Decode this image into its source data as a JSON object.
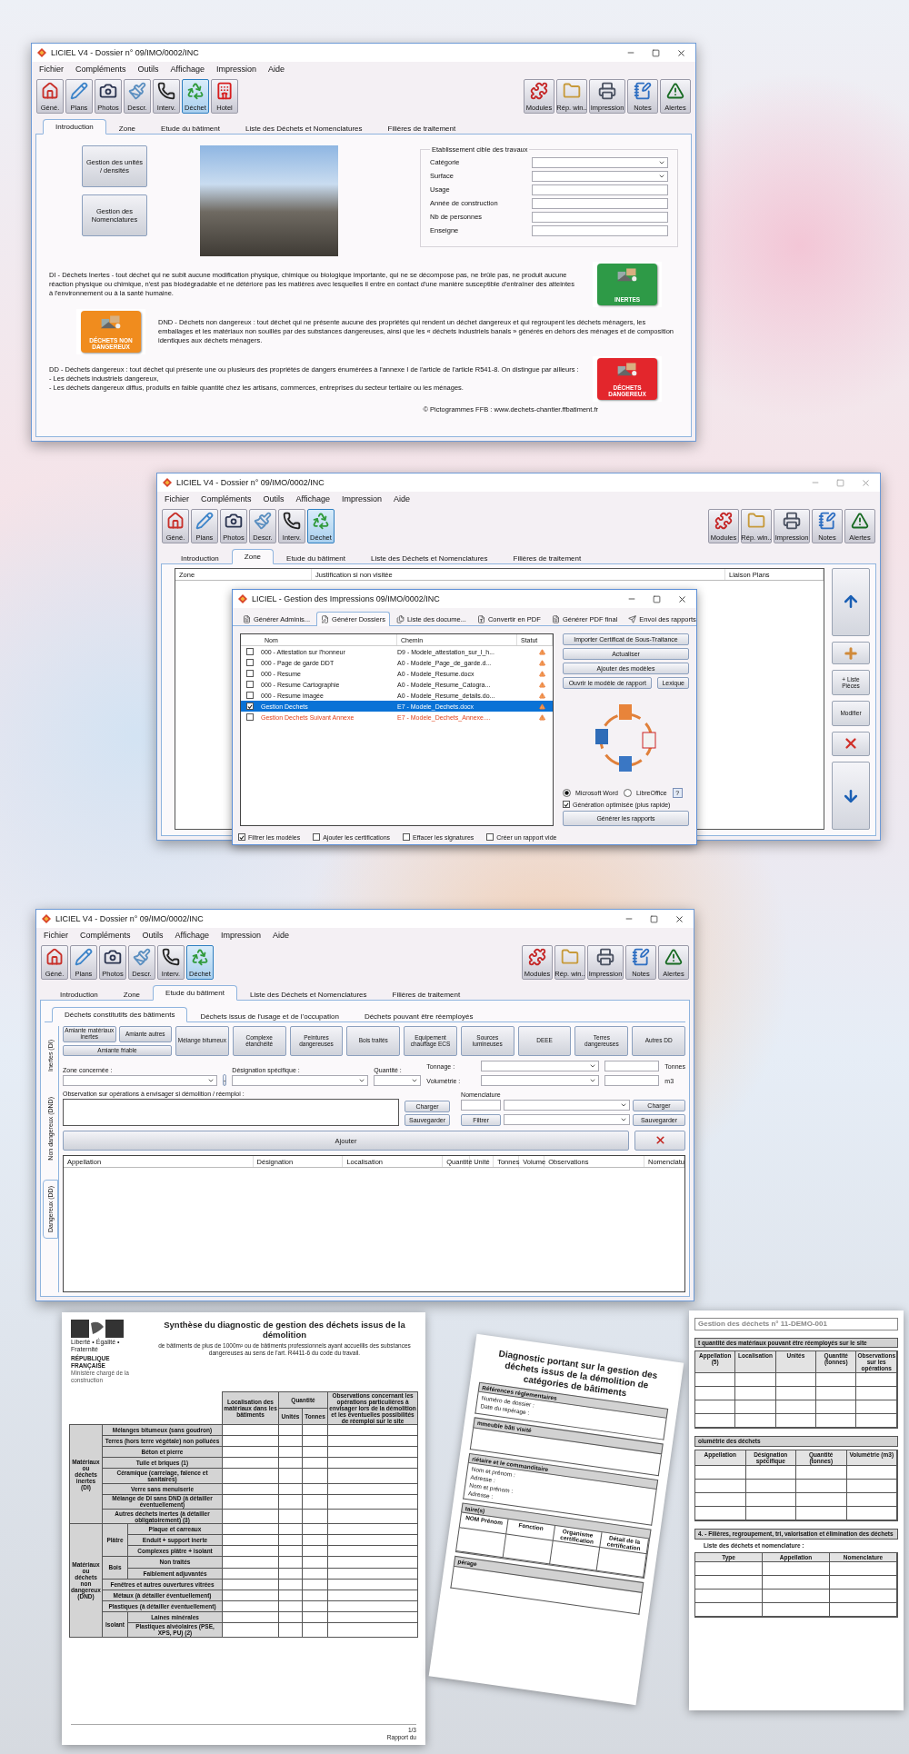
{
  "windows": [
    {
      "kind": "introduction",
      "title": "LICIEL V4 - Dossier n° 09/IMO/0002/INC",
      "menu": [
        "Fichier",
        "Compléments",
        "Outils",
        "Affichage",
        "Impression",
        "Aide"
      ],
      "tools": [
        {
          "label": "Géné.",
          "selected": false
        },
        {
          "label": "Plans",
          "selected": false
        },
        {
          "label": "Photos",
          "selected": false
        },
        {
          "label": "Descr.",
          "selected": false
        },
        {
          "label": "Interv.",
          "selected": false
        },
        {
          "label": "Déchet",
          "selected": true
        },
        {
          "label": "Hotel",
          "selected": false
        }
      ],
      "right_tools": [
        "Modules",
        "Rép. win..",
        "Impression",
        "Notes",
        "Alertes"
      ],
      "tabs": [
        {
          "label": "Introduction",
          "selected": true
        },
        {
          "label": "Zone",
          "selected": false
        },
        {
          "label": "Etude du bâtiment",
          "selected": false
        },
        {
          "label": "Liste des Déchets et Nomenclatures",
          "selected": false
        },
        {
          "label": "Filières de traitement",
          "selected": false
        }
      ],
      "intro": {
        "buttons": [
          "Gestion des unités / densités",
          "Gestion des Nomenclatures"
        ],
        "form_title": "Etablissement cible des travaux",
        "fields": [
          {
            "label": "Catégorie",
            "kind": "select"
          },
          {
            "label": "Surface",
            "kind": "select"
          },
          {
            "label": "Usage",
            "kind": "text"
          },
          {
            "label": "Année de construction",
            "kind": "text"
          },
          {
            "label": "Nb de personnes",
            "kind": "text"
          },
          {
            "label": "Enseigne",
            "kind": "text"
          }
        ],
        "paragraphs": [
          {
            "text": "DI - Déchets Inertes - tout déchet qui ne subit aucune modification physique, chimique ou biologique importante, qui ne se décompose pas, ne brûle pas, ne produit aucune réaction physique ou chimique, n'est pas biodégradable et ne détériore pas les matières avec lesquelles il entre en contact d'une manière susceptible d'entraîner des atteintes à l'environnement ou à la santé humaine.",
            "badge": {
              "label": "INERTES",
              "color": "#2e9a47"
            }
          },
          {
            "text": "DND - Déchets non dangereux : tout déchet qui ne présente aucune des propriétés qui rendent un déchet dangereux et qui regroupent les déchets ménagers, les emballages et les matériaux non souillés par des substances dangereuses, ainsi que les « déchets industriels banals » générés en dehors des ménages et de composition identiques aux déchets ménagers.",
            "badge": {
              "label": "DÉCHETS NON DANGEREUX",
              "color": "#f08c1e"
            }
          },
          {
            "text": "DD - Déchets dangereux : tout déchet qui présente une ou plusieurs des propriétés de dangers énumérées à l'annexe I de l'article de l'article R541-8. On distingue par ailleurs :",
            "bullets": [
              "- Les déchets industriels dangereux,",
              "- Les déchets dangereux diffus, produits en faible quantité chez les artisans, commerces, entreprises du secteur tertiaire ou les ménages."
            ],
            "badge": {
              "label": "DÉCHETS DANGEREUX",
              "color": "#e3262c"
            }
          }
        ],
        "credit": "© Pictogrammes FFB :  www.dechets-chantier.ffbatiment.fr"
      }
    },
    {
      "kind": "zones",
      "title": "LICIEL V4 - Dossier n° 09/IMO/0002/INC",
      "menu": [
        "Fichier",
        "Compléments",
        "Outils",
        "Affichage",
        "Impression",
        "Aide"
      ],
      "tools": [
        {
          "label": "Géné.",
          "selected": false
        },
        {
          "label": "Plans",
          "selected": false
        },
        {
          "label": "Photos",
          "selected": false
        },
        {
          "label": "Descr.",
          "selected": false
        },
        {
          "label": "Interv.",
          "selected": false
        },
        {
          "label": "Déchet",
          "selected": true
        }
      ],
      "right_tools": [
        "Modules",
        "Rép. win..",
        "Impression",
        "Notes",
        "Alertes"
      ],
      "tabs": [
        {
          "label": "Introduction",
          "selected": false
        },
        {
          "label": "Zone",
          "selected": true
        },
        {
          "label": "Etude du bâtiment",
          "selected": false
        },
        {
          "label": "Liste des Déchets et Nomenclatures",
          "selected": false
        },
        {
          "label": "Filières de traitement",
          "selected": false
        }
      ],
      "zones": {
        "columns": [
          "Zone",
          "Justification si non visitée",
          "Liaison Plans"
        ],
        "side_buttons": [
          {
            "kind": "up"
          },
          {
            "kind": "add"
          },
          {
            "kind": "text",
            "label": "+ Liste Pièces"
          },
          {
            "kind": "text",
            "label": "Modifier"
          },
          {
            "kind": "delete"
          },
          {
            "kind": "down"
          }
        ],
        "dialog": {
          "title": "LICIEL - Gestion des Impressions  09/IMO/0002/INC",
          "tabs": [
            {
              "label": "Générer Adminis...",
              "selected": false
            },
            {
              "label": "Générer Dossiers",
              "selected": true
            },
            {
              "label": "Liste des docume...",
              "selected": false
            },
            {
              "label": "Convertir en PDF",
              "selected": false
            },
            {
              "label": "Générer PDF final",
              "selected": false
            },
            {
              "label": "Envoi des rapports",
              "selected": false
            }
          ],
          "columns": [
            "Nom",
            "Chemin",
            "Statut"
          ],
          "rows": [
            {
              "name": "000 - Attestation sur l'honneur",
              "path": "D9 - Modele_attestation_sur_l_h...",
              "checked": false,
              "selected": false,
              "kind": "normal"
            },
            {
              "name": "000 - Page de garde DDT",
              "path": "A0 - Modele_Page_de_garde.d...",
              "checked": false,
              "selected": false,
              "kind": "normal"
            },
            {
              "name": "000 - Resume",
              "path": "A0 - Modele_Resume.docx",
              "checked": false,
              "selected": false,
              "kind": "normal"
            },
            {
              "name": "000 - Resume Cartographie",
              "path": "A0 - Modele_Resume_Catogra...",
              "checked": false,
              "selected": false,
              "kind": "normal"
            },
            {
              "name": "000 - Resume imagée",
              "path": "A0 - Modele_Resume_details.do...",
              "checked": false,
              "selected": false,
              "kind": "normal"
            },
            {
              "name": "Gestion Dechets",
              "path": "E7 - Modele_Dechets.docx",
              "checked": true,
              "selected": true,
              "kind": "normal"
            },
            {
              "name": "Gestion Dechets Suivant Annexe",
              "path": "E7 - Modele_Dechets_Annexe....",
              "checked": false,
              "selected": false,
              "kind": "annex"
            }
          ],
          "buttons": [
            "Importer Certificat de Sous-Traitance",
            "Actualiser",
            "Ajouter des modèles",
            "Ouvrir le modèle de rapport",
            "Lexique"
          ],
          "engines": [
            {
              "label": "Microsoft Word",
              "selected": true
            },
            {
              "label": "LibreOffice",
              "selected": false
            }
          ],
          "help": "?",
          "optimized": {
            "label": "Génération optimisée (plus rapide)",
            "checked": true
          },
          "generate": "Générer les rapports",
          "options": [
            {
              "label": "Filtrer les modèles",
              "checked": true
            },
            {
              "label": "Ajouter les certifications",
              "checked": false
            },
            {
              "label": "Effacer les signatures",
              "checked": false
            },
            {
              "label": "Créer un rapport vide",
              "checked": false
            }
          ]
        }
      }
    },
    {
      "kind": "building",
      "title": "LICIEL V4 - Dossier n° 09/IMO/0002/INC",
      "menu": [
        "Fichier",
        "Compléments",
        "Outils",
        "Affichage",
        "Impression",
        "Aide"
      ],
      "tools": [
        {
          "label": "Géné.",
          "selected": false
        },
        {
          "label": "Plans",
          "selected": false
        },
        {
          "label": "Photos",
          "selected": false
        },
        {
          "label": "Descr.",
          "selected": false
        },
        {
          "label": "Interv.",
          "selected": false
        },
        {
          "label": "Déchet",
          "selected": true
        }
      ],
      "right_tools": [
        "Modules",
        "Rép. win..",
        "Impression",
        "Notes",
        "Alertes"
      ],
      "tabs": [
        {
          "label": "Introduction",
          "selected": false
        },
        {
          "label": "Zone",
          "selected": false
        },
        {
          "label": "Etude du bâtiment",
          "selected": true
        },
        {
          "label": "Liste des Déchets et Nomenclatures",
          "selected": false
        },
        {
          "label": "Filières de traitement",
          "selected": false
        }
      ],
      "building": {
        "subtabs": [
          {
            "label": "Déchets constitutifs des bâtiments",
            "selected": true
          },
          {
            "label": "Déchets issus de l'usage et de l'occupation",
            "selected": false
          },
          {
            "label": "Déchets pouvant être réemployés",
            "selected": false
          }
        ],
        "side_tabs": [
          {
            "label": "Inertes (DI)",
            "selected": false
          },
          {
            "label": "Non dangereux (DND)",
            "selected": false
          },
          {
            "label": "Dangereux (DD)",
            "selected": true
          }
        ],
        "categories": [
          {
            "label": "Amiante matériaux inertes",
            "kind": "grouped"
          },
          {
            "label": "Amiante autres",
            "kind": "grouped"
          },
          {
            "label": "Amiante friable",
            "kind": "grouped-wide"
          },
          {
            "label": "Mélange bitumeux",
            "kind": "normal"
          },
          {
            "label": "Complexe étanchéité",
            "kind": "normal"
          },
          {
            "label": "Peintures dangereuses",
            "kind": "normal"
          },
          {
            "label": "Bois traités",
            "kind": "normal"
          },
          {
            "label": "Equipement chauffage ECS",
            "kind": "normal"
          },
          {
            "label": "Sources lumineuses",
            "kind": "normal"
          },
          {
            "label": "DEEE",
            "kind": "normal"
          },
          {
            "label": "Terres dangereuses",
            "kind": "normal"
          },
          {
            "label": "Autres DD",
            "kind": "normal"
          }
        ],
        "zone_label": "Zone concernée :",
        "minus": "-",
        "designation_label": "Désignation spécifique :",
        "quantity_label": "Quantité :",
        "tonnage_label": "Tonnage :",
        "tonnage_unit": "Tonnes",
        "volume_label": "Volumétrie :",
        "volume_unit": "m3",
        "observation_label": "Observation sur opérations à envisager si démolition / réemploi :",
        "load": "Charger",
        "save": "Sauvegarder",
        "nomenclature_label": "Nomenclature",
        "filter": "Filtrer",
        "load2": "Charger",
        "save2": "Sauvegarder",
        "add": "Ajouter",
        "columns": [
          "Appellation",
          "Désignation",
          "Localisation",
          "Quantité",
          "Unité",
          "Tonnes",
          "Volume",
          "Observations",
          "Nomenclatu"
        ]
      }
    }
  ],
  "documents": {
    "synthesis": {
      "motto": "Liberté • Égalité • Fraternité",
      "republic": "RÉPUBLIQUE FRANÇAISE",
      "ministry": "Ministère chargé de la construction",
      "title": "Synthèse du diagnostic de gestion des déchets issus de la démolition",
      "subtitle": "de bâtiments de plus de 1000m² ou de bâtiments professionnels ayant accueillis des substances dangereuses au sens de l'art. R4411-6 du code du travail.",
      "location_header": "Localisation des matériaux dans les bâtiments",
      "quantity_header": "Quantité",
      "unit_header": "Unités",
      "tonnes_header": "Tonnes",
      "observation_header": "Observations concernant les opérations particulières à envisager lors de la démolition et les éventuelles possibilités de réemploi sur le site",
      "groups": [
        {
          "label": "Matériaux ou déchets inertes (DI)",
          "subgroups": [
            {
              "items": [
                "Mélanges bitumeux (sans goudron)",
                "Terres (hors terre végétale) non polluées",
                "Béton et pierre",
                "Tuile et briques (1)",
                "Céramique (carrelage, faïence et sanitaires)",
                "Verre sans menuiserie",
                "Mélange de DI sans DND (à détailler éventuellement)",
                "Autres déchets inertes (à détailler obligatoirement) (3)"
              ]
            }
          ]
        },
        {
          "label": "Matériaux ou déchets non dangereux (DND)",
          "subgroups": [
            {
              "label": "Plâtre",
              "items": [
                "Plaque et carreaux",
                "Enduit + support inerte",
                "Complexes plâtre + isolant"
              ]
            },
            {
              "label": "Bois",
              "items": [
                "Non traités",
                "Faiblement adjuvantés"
              ]
            },
            {
              "items": [
                "Fenêtres et autres ouvertures vitrées"
              ]
            },
            {
              "items": [
                "Métaux (à détailler éventuellement)"
              ]
            },
            {
              "items": [
                "Plastiques (à détailler éventuellement)"
              ]
            },
            {
              "label": "Isolant",
              "items": [
                "Laines minérales",
                "Plastiques alvéolaires (PSE, XPS, PU) (2)"
              ]
            }
          ]
        }
      ],
      "page": "1/3",
      "footer": "Rapport du"
    },
    "diagnostic": {
      "title": "Diagnostic portant sur la gestion des déchets issus de la démolition de catégories de bâtiments",
      "sections": [
        {
          "heading": "Références réglementaires",
          "fields": [
            "Numéro de dossier :",
            "Date du repérage :"
          ]
        },
        {
          "heading": "mmeuble bâti visité"
        },
        {
          "heading": "riétaire et le commanditaire",
          "fields": [
            "Nom et prénom :",
            "Adresse :",
            "Nom et prénom :",
            "Adresse :"
          ]
        },
        {
          "heading": "taire(s)",
          "columns": [
            "NOM Prénom",
            "Fonction",
            "Organisme certification",
            "Détail de la certification"
          ]
        },
        {
          "heading": "pérage"
        }
      ]
    },
    "management": {
      "header": "Gestion des déchets n° 11-DEMO-001",
      "sections": [
        {
          "heading": "t quantité des matériaux pouvant être réemployés sur le site",
          "columns": [
            "Appellation (5)",
            "Localisation",
            "Unités",
            "Quantité (tonnes)",
            "Observations sur les opérations"
          ]
        },
        {
          "heading": "olumétrie des déchets",
          "columns": [
            "Appellation",
            "Désignation spécifique",
            "Quantité (tonnes)",
            "Volumétrie (m3)"
          ]
        },
        {
          "heading": "4. - Filières, regroupement, tri, valorisation et élimination des déchets",
          "note": "Liste des déchets et nomenclature :",
          "columns": [
            "Type",
            "Appellation",
            "Nomenclature"
          ]
        }
      ]
    }
  }
}
